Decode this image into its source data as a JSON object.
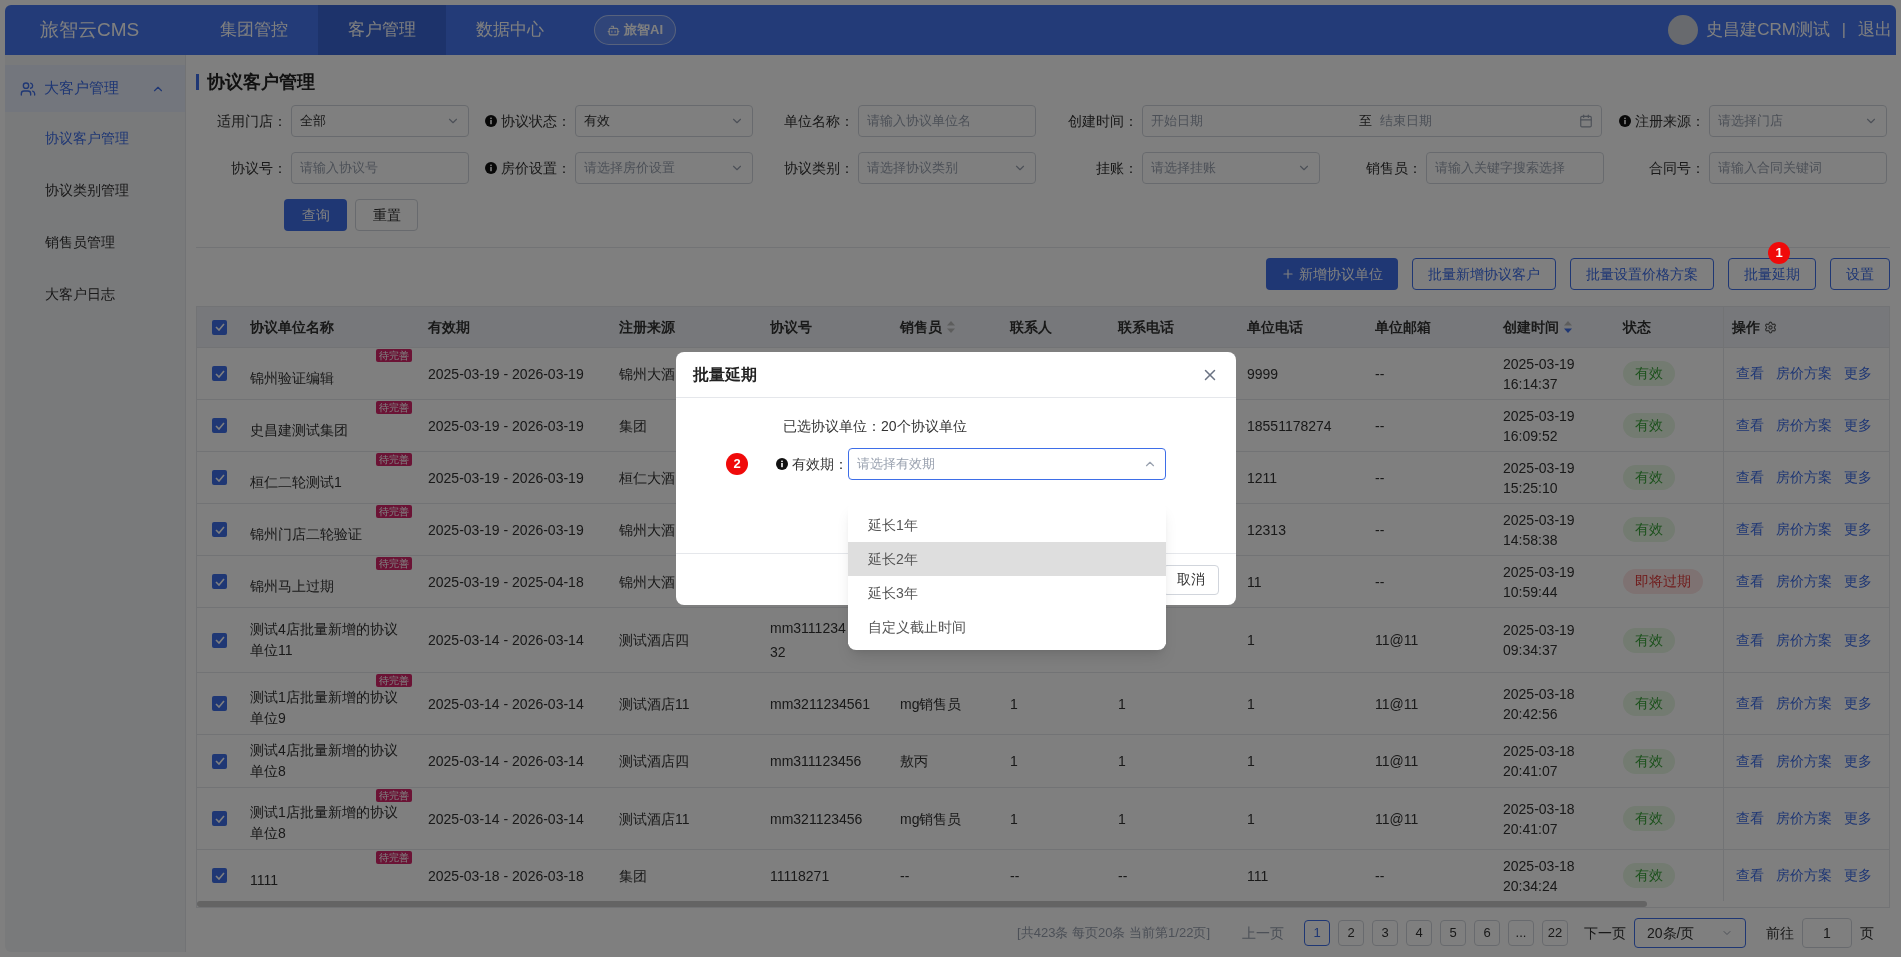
{
  "top_nav": {
    "logo": "旅智云CMS",
    "tabs": [
      {
        "label": "集团管控",
        "selected": false
      },
      {
        "label": "客户管理",
        "selected": true
      },
      {
        "label": "数据中心",
        "selected": false
      }
    ],
    "ai_button": "旅智AI",
    "user_name": "史昌建CRM测试",
    "separator": "|",
    "logout": "退出"
  },
  "sidebar": {
    "group": {
      "label": "大客户管理",
      "expanded": true,
      "children": [
        {
          "label": "协议客户管理",
          "selected": true
        },
        {
          "label": "协议类别管理",
          "selected": false
        },
        {
          "label": "销售员管理",
          "selected": false
        },
        {
          "label": "大客户日志",
          "selected": false
        }
      ]
    }
  },
  "page_title": "协议客户管理",
  "filters": [
    {
      "label": "适用门店：",
      "info": false,
      "kind": "select",
      "value": "全部"
    },
    {
      "label": "协议状态：",
      "info": true,
      "kind": "select",
      "value": "有效"
    },
    {
      "label": "单位名称：",
      "info": false,
      "kind": "input",
      "placeholder": "请输入协议单位名"
    },
    {
      "label": "创建时间：",
      "info": false,
      "kind": "date_range",
      "placeholder": "开始日期",
      "separator": "至",
      "placeholder_end": "结束日期"
    },
    {
      "label": "注册来源：",
      "info": true,
      "kind": "select",
      "placeholder": "请选择门店"
    },
    {
      "label": "协议号：",
      "info": false,
      "kind": "input",
      "placeholder": "请输入协议号"
    },
    {
      "label": "房价设置：",
      "info": true,
      "kind": "select",
      "placeholder": "请选择房价设置"
    },
    {
      "label": "协议类别：",
      "info": false,
      "kind": "select",
      "placeholder": "请选择协议类别"
    },
    {
      "label": "挂账：",
      "info": false,
      "kind": "select",
      "placeholder": "请选择挂账"
    },
    {
      "label": "销售员：",
      "info": false,
      "kind": "input",
      "placeholder": "请输入关键字搜索选择"
    },
    {
      "label": "合同号：",
      "info": false,
      "kind": "input",
      "placeholder": "请输入合同关键词"
    }
  ],
  "filter_buttons": [
    {
      "label": "查询",
      "kind": "primary"
    },
    {
      "label": "重置",
      "kind": "default"
    }
  ],
  "toolbar": [
    {
      "label": "新增协议单位",
      "kind": "primary"
    },
    {
      "label": "批量新增协议客户",
      "kind": "outline"
    },
    {
      "label": "批量设置价格方案",
      "kind": "outline"
    },
    {
      "label": "批量延期",
      "kind": "outline",
      "marker": "1"
    },
    {
      "label": "设置",
      "kind": "outline"
    }
  ],
  "table": {
    "select_all": true,
    "columns": [
      {
        "label": "协议单位名称",
        "sortable": false,
        "gear": false
      },
      {
        "label": "有效期",
        "sortable": false,
        "gear": false
      },
      {
        "label": "注册来源",
        "sortable": false,
        "gear": false
      },
      {
        "label": "协议号",
        "sortable": false,
        "gear": false
      },
      {
        "label": "销售员",
        "sortable": true,
        "sorted_desc": false,
        "gear": false
      },
      {
        "label": "联系人",
        "sortable": false,
        "gear": false
      },
      {
        "label": "联系电话",
        "sortable": false,
        "gear": false
      },
      {
        "label": "单位电话",
        "sortable": false,
        "gear": false
      },
      {
        "label": "单位邮箱",
        "sortable": false,
        "gear": false
      },
      {
        "label": "创建时间",
        "sortable": true,
        "sorted_desc": true,
        "gear": false
      },
      {
        "label": "状态",
        "sortable": false,
        "gear": false
      },
      {
        "label": "操作",
        "sortable": false,
        "gear": true
      }
    ],
    "rows": [
      {
        "checked": true,
        "tag": "待完善",
        "cells": [
          "锦州验证编辑",
          "2025-03-19 - 2026-03-19",
          "锦州大酒",
          "",
          "",
          "",
          "",
          "9999",
          "--"
        ],
        "created": [
          "2025-03-19",
          "16:14:37"
        ],
        "status": {
          "label": "有效",
          "kind": "active"
        },
        "actions": [
          "查看",
          "房价方案",
          "更多"
        ]
      },
      {
        "checked": true,
        "tag": "待完善",
        "cells": [
          "史昌建测试集团",
          "2025-03-19 - 2026-03-19",
          "集团",
          "",
          "",
          "",
          "",
          "18551178274",
          "--"
        ],
        "created": [
          "2025-03-19",
          "16:09:52"
        ],
        "status": {
          "label": "有效",
          "kind": "active"
        },
        "actions": [
          "查看",
          "房价方案",
          "更多"
        ]
      },
      {
        "checked": true,
        "tag": "待完善",
        "cells": [
          "桓仁二轮测试1",
          "2025-03-19 - 2026-03-19",
          "桓仁大酒",
          "",
          "",
          "",
          "",
          "1211",
          "--"
        ],
        "created": [
          "2025-03-19",
          "15:25:10"
        ],
        "status": {
          "label": "有效",
          "kind": "active"
        },
        "actions": [
          "查看",
          "房价方案",
          "更多"
        ]
      },
      {
        "checked": true,
        "tag": "待完善",
        "cells": [
          "锦州门店二轮验证",
          "2025-03-19 - 2026-03-19",
          "锦州大酒",
          "",
          "",
          "",
          "",
          "12313",
          "--"
        ],
        "created": [
          "2025-03-19",
          "14:58:38"
        ],
        "status": {
          "label": "有效",
          "kind": "active"
        },
        "actions": [
          "查看",
          "房价方案",
          "更多"
        ]
      },
      {
        "checked": true,
        "tag": "待完善",
        "cells": [
          "锦州马上过期",
          "2025-03-19 - 2025-04-18",
          "锦州大酒",
          "",
          "",
          "",
          "",
          "11",
          "--"
        ],
        "created": [
          "2025-03-19",
          "10:59:44"
        ],
        "status": {
          "label": "即将过期",
          "kind": "expiring"
        },
        "actions": [
          "查看",
          "房价方案",
          "更多"
        ]
      },
      {
        "checked": true,
        "cells": [
          "测试4店批量新增的协议单位11",
          "2025-03-14 - 2026-03-14",
          "测试酒店四",
          "mm3111234\n32",
          "",
          "",
          "",
          "1",
          "11@11"
        ],
        "created": [
          "2025-03-19",
          "09:34:37"
        ],
        "status": {
          "label": "有效",
          "kind": "active"
        },
        "actions": [
          "查看",
          "房价方案",
          "更多"
        ]
      },
      {
        "checked": true,
        "tag": "待完善",
        "cells": [
          "测试1店批量新增的协议单位9",
          "2025-03-14 - 2026-03-14",
          "测试酒店11",
          "mm3211234561",
          "mg销售员",
          "1",
          "1",
          "1",
          "11@11"
        ],
        "created": [
          "2025-03-18",
          "20:42:56"
        ],
        "status": {
          "label": "有效",
          "kind": "active"
        },
        "actions": [
          "查看",
          "房价方案",
          "更多"
        ]
      },
      {
        "checked": true,
        "cells": [
          "测试4店批量新增的协议单位8",
          "2025-03-14 - 2026-03-14",
          "测试酒店四",
          "mm311123456",
          "敖丙",
          "1",
          "1",
          "1",
          "11@11"
        ],
        "created": [
          "2025-03-18",
          "20:41:07"
        ],
        "status": {
          "label": "有效",
          "kind": "active"
        },
        "actions": [
          "查看",
          "房价方案",
          "更多"
        ]
      },
      {
        "checked": true,
        "tag": "待完善",
        "cells": [
          "测试1店批量新增的协议单位8",
          "2025-03-14 - 2026-03-14",
          "测试酒店11",
          "mm321123456",
          "mg销售员",
          "1",
          "1",
          "1",
          "11@11"
        ],
        "created": [
          "2025-03-18",
          "20:41:07"
        ],
        "status": {
          "label": "有效",
          "kind": "active"
        },
        "actions": [
          "查看",
          "房价方案",
          "更多"
        ]
      },
      {
        "checked": true,
        "tag": "待完善",
        "cells": [
          "1111",
          "2025-03-18 - 2026-03-18",
          "集团",
          "11118271",
          "--",
          "--",
          "--",
          "111",
          "--"
        ],
        "created": [
          "2025-03-18",
          "20:34:24"
        ],
        "status": {
          "label": "有效",
          "kind": "active"
        },
        "actions": [
          "查看",
          "房价方案",
          "更多"
        ]
      }
    ]
  },
  "pagination": {
    "summary": "[共423条 每页20条 当前第1/22页]",
    "prev": "上一页",
    "prev_disabled": true,
    "pages": [
      {
        "label": "1",
        "selected": true
      },
      {
        "label": "2",
        "selected": false
      },
      {
        "label": "3",
        "selected": false
      },
      {
        "label": "4",
        "selected": false
      },
      {
        "label": "5",
        "selected": false
      },
      {
        "label": "6",
        "selected": false
      },
      {
        "label": "...",
        "selected": false
      },
      {
        "label": "22",
        "selected": false
      }
    ],
    "next": "下一页",
    "page_size": "20条/页",
    "goto_label": "前往",
    "goto_value": "1",
    "goto_unit": "页"
  },
  "modal": {
    "title": "批量延期",
    "selected_label": "已选协议单位：",
    "selected_value": "20个协议单位",
    "field": {
      "marker": "2",
      "info": true,
      "label": "有效期：",
      "placeholder": "请选择有效期",
      "open": true
    },
    "options": [
      {
        "label": "延长1年",
        "highlighted": false
      },
      {
        "label": "延长2年",
        "highlighted": true
      },
      {
        "label": "延长3年",
        "highlighted": false
      },
      {
        "label": "自定义截止时间",
        "highlighted": false
      }
    ],
    "cancel": "取消"
  }
}
